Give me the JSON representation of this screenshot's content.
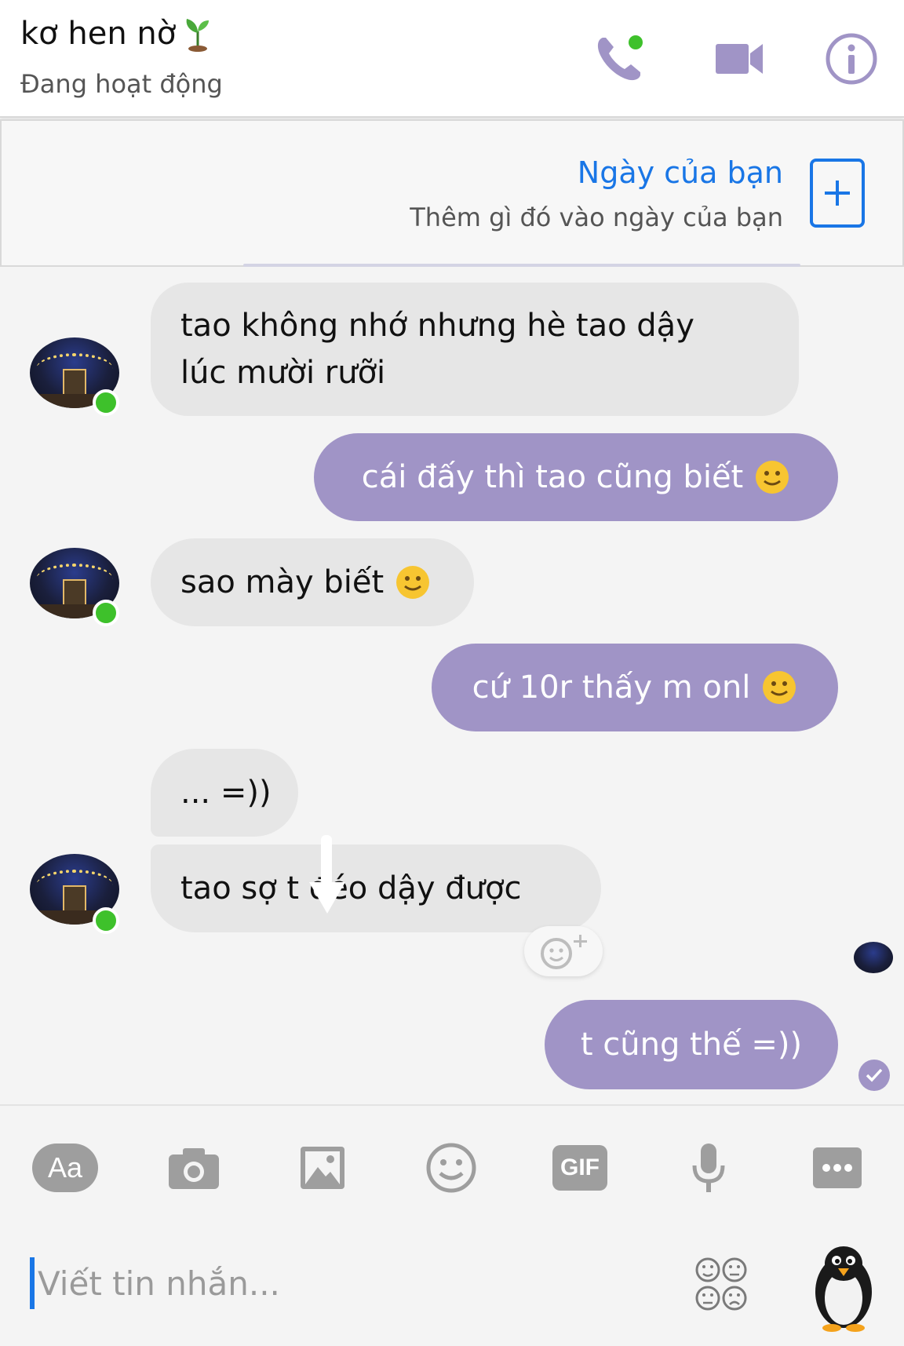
{
  "header": {
    "contact_name": "kơ hen nờ",
    "status": "Đang hoạt động",
    "accent_color": "#a094c6",
    "icons": [
      "voice-call-icon",
      "video-call-icon",
      "info-icon"
    ]
  },
  "my_day": {
    "title": "Ngày của bạn",
    "subtitle": "Thêm gì đó vào ngày của bạn",
    "link_color": "#1976e6"
  },
  "messages": [
    {
      "sender": "them",
      "text": "tao không nhớ nhưng hè tao dậy\nlúc mười rưỡi"
    },
    {
      "sender": "me",
      "text": "cái đấy thì tao cũng biết",
      "emoji": "slightly-smiling-face"
    },
    {
      "sender": "them",
      "text": "sao mày biết",
      "emoji": "slightly-smiling-face"
    },
    {
      "sender": "me",
      "text": "cứ 10r thấy m onl",
      "emoji": "slightly-smiling-face"
    },
    {
      "sender": "them",
      "text": "... =))"
    },
    {
      "sender": "them",
      "text": "tao sợ t đéo dậy được"
    },
    {
      "sender": "me",
      "text": "t cũng thế =))"
    }
  ],
  "composer": {
    "placeholder": "Viết tin nhắn...",
    "tools": [
      "text-size-icon",
      "camera-icon",
      "gallery-icon",
      "emoji-icon",
      "gif-icon",
      "microphone-icon",
      "more-icon"
    ],
    "text_tool_label": "Aa",
    "gif_label": "GIF"
  },
  "colors": {
    "outgoing_bubble": "#a094c6",
    "incoming_bubble": "#e6e6e6",
    "online": "#3ec12b"
  }
}
